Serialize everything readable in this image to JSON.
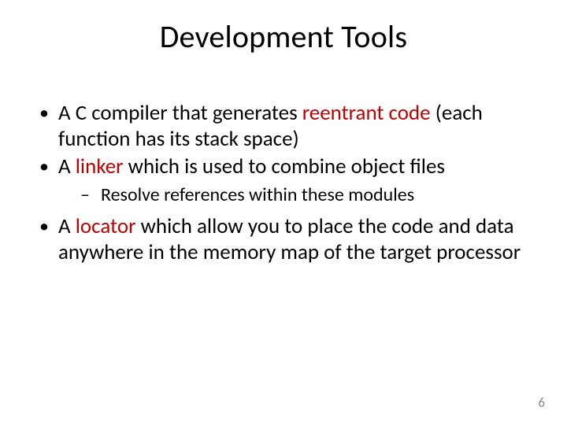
{
  "title": "Development Tools",
  "bullets": {
    "b1_pre": "A C compiler that generates ",
    "b1_red": "reentrant code",
    "b1_post": " (each function has its stack space)",
    "b2_pre": "A ",
    "b2_red": "linker",
    "b2_post": " which is used to combine object files",
    "b2_sub": "Resolve references within these modules",
    "b3_pre": "A ",
    "b3_red": "locator",
    "b3_post": " which allow you to place the code and data anywhere in the memory map of the target processor"
  },
  "page_number": "6"
}
